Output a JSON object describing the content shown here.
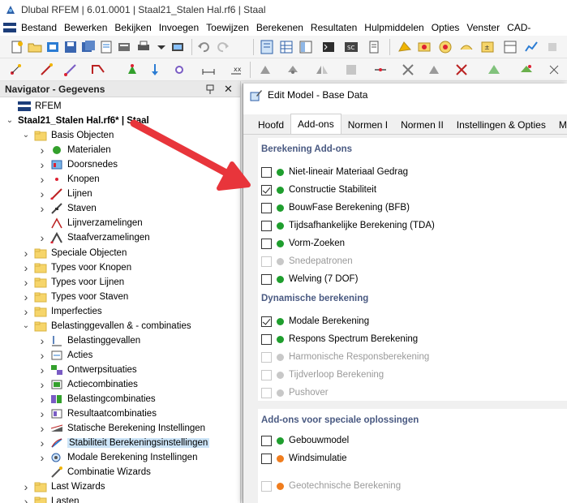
{
  "window": {
    "title": "Dlubal RFEM | 6.01.0001 | Staal21_Stalen Hal.rf6 | Staal"
  },
  "menu": [
    "Bestand",
    "Bewerken",
    "Bekijken",
    "Invoegen",
    "Toewijzen",
    "Berekenen",
    "Resultaten",
    "Hulpmiddelen",
    "Opties",
    "Venster",
    "CAD-"
  ],
  "navigator": {
    "title": "Navigator - Gegevens",
    "items": [
      {
        "label": "RFEM",
        "depth": 0,
        "chevron": "",
        "icon": "rfem-flag-icon"
      },
      {
        "label": "Staal21_Stalen Hal.rf6* | Staal",
        "depth": 0,
        "chevron": "open",
        "icon": "",
        "bold": true
      },
      {
        "label": "Basis Objecten",
        "depth": 1,
        "chevron": "open",
        "icon": "folder-icon"
      },
      {
        "label": "Materialen",
        "depth": 2,
        "chevron": "closed",
        "icon": "material-icon"
      },
      {
        "label": "Doorsnedes",
        "depth": 2,
        "chevron": "closed",
        "icon": "section-icon"
      },
      {
        "label": "Knopen",
        "depth": 2,
        "chevron": "closed",
        "icon": "node-icon"
      },
      {
        "label": "Lijnen",
        "depth": 2,
        "chevron": "closed",
        "icon": "line-icon"
      },
      {
        "label": "Staven",
        "depth": 2,
        "chevron": "closed",
        "icon": "member-icon"
      },
      {
        "label": "Lijnverzamelingen",
        "depth": 2,
        "chevron": "",
        "icon": "line-set-icon"
      },
      {
        "label": "Staafverzamelingen",
        "depth": 2,
        "chevron": "closed",
        "icon": "member-set-icon"
      },
      {
        "label": "Speciale Objecten",
        "depth": 1,
        "chevron": "closed",
        "icon": "folder-icon"
      },
      {
        "label": "Types voor Knopen",
        "depth": 1,
        "chevron": "closed",
        "icon": "folder-icon"
      },
      {
        "label": "Types voor Lijnen",
        "depth": 1,
        "chevron": "closed",
        "icon": "folder-icon"
      },
      {
        "label": "Types voor Staven",
        "depth": 1,
        "chevron": "closed",
        "icon": "folder-icon"
      },
      {
        "label": "Imperfecties",
        "depth": 1,
        "chevron": "closed",
        "icon": "folder-icon"
      },
      {
        "label": "Belastinggevallen & - combinaties",
        "depth": 1,
        "chevron": "open",
        "icon": "folder-icon"
      },
      {
        "label": "Belastinggevallen",
        "depth": 2,
        "chevron": "closed",
        "icon": "load-case-icon"
      },
      {
        "label": "Acties",
        "depth": 2,
        "chevron": "closed",
        "icon": "action-icon"
      },
      {
        "label": "Ontwerpsituaties",
        "depth": 2,
        "chevron": "closed",
        "icon": "design-situation-icon"
      },
      {
        "label": "Actiecombinaties",
        "depth": 2,
        "chevron": "closed",
        "icon": "action-combination-icon"
      },
      {
        "label": "Belastingcombinaties",
        "depth": 2,
        "chevron": "closed",
        "icon": "load-combination-icon"
      },
      {
        "label": "Resultaatcombinaties",
        "depth": 2,
        "chevron": "closed",
        "icon": "result-combination-icon"
      },
      {
        "label": "Statische Berekening Instellingen",
        "depth": 2,
        "chevron": "closed",
        "icon": "static-settings-icon"
      },
      {
        "label": "Stabiliteit Berekeningsinstellingen",
        "depth": 2,
        "chevron": "closed",
        "icon": "stability-settings-icon",
        "selected": true
      },
      {
        "label": "Modale Berekening Instellingen",
        "depth": 2,
        "chevron": "closed",
        "icon": "modal-settings-icon"
      },
      {
        "label": "Combinatie Wizards",
        "depth": 2,
        "chevron": "",
        "icon": "combination-wizard-icon"
      },
      {
        "label": "Last Wizards",
        "depth": 1,
        "chevron": "closed",
        "icon": "folder-icon"
      },
      {
        "label": "Lasten",
        "depth": 1,
        "chevron": "closed",
        "icon": "folder-icon"
      }
    ]
  },
  "dialog": {
    "title": "Edit Model - Base Data",
    "tabs": [
      "Hoofd",
      "Add-ons",
      "Normen I",
      "Normen II",
      "Instellingen & Opties",
      "M"
    ],
    "active_tab": 1,
    "groups": [
      {
        "title": "Berekening Add-ons",
        "options": [
          {
            "label": "Niet-lineair Materiaal Gedrag",
            "checked": false,
            "enabled": true,
            "dot": "#1f9e2e"
          },
          {
            "label": "Constructie Stabiliteit",
            "checked": true,
            "enabled": true,
            "dot": "#1f9e2e"
          },
          {
            "label": "BouwFase Berekening (BFB)",
            "checked": false,
            "enabled": true,
            "dot": "#1f9e2e"
          },
          {
            "label": "Tijdsafhankelijke Berekening (TDA)",
            "checked": false,
            "enabled": true,
            "dot": "#1f9e2e"
          },
          {
            "label": "Vorm-Zoeken",
            "checked": false,
            "enabled": true,
            "dot": "#1f9e2e"
          },
          {
            "label": "Snedepatronen",
            "checked": false,
            "enabled": false,
            "dot": "#c8c8c8"
          },
          {
            "label": "Welving (7 DOF)",
            "checked": false,
            "enabled": true,
            "dot": "#1f9e2e"
          }
        ]
      },
      {
        "title": "Dynamische berekening",
        "options": [
          {
            "label": "Modale Berekening",
            "checked": true,
            "enabled": true,
            "dot": "#1f9e2e"
          },
          {
            "label": "Respons Spectrum Berekening",
            "checked": false,
            "enabled": true,
            "dot": "#1f9e2e"
          },
          {
            "label": "Harmonische Responsberekening",
            "checked": false,
            "enabled": false,
            "dot": "#c8c8c8"
          },
          {
            "label": "Tijdverloop Berekening",
            "checked": false,
            "enabled": false,
            "dot": "#c8c8c8"
          },
          {
            "label": "Pushover",
            "checked": false,
            "enabled": false,
            "dot": "#c8c8c8"
          }
        ]
      },
      {
        "title": "Add-ons voor speciale oplossingen",
        "options": [
          {
            "label": "Gebouwmodel",
            "checked": false,
            "enabled": true,
            "dot": "#1f9e2e"
          },
          {
            "label": "Windsimulatie",
            "checked": false,
            "enabled": true,
            "dot": "#f07d1e"
          },
          {
            "label": "Geotechnische Berekening",
            "checked": false,
            "enabled": false,
            "dot": "#f07d1e"
          }
        ]
      }
    ]
  },
  "colors": {
    "accent": "#4a5a82",
    "arrow": "#e8353b",
    "selection": "#cce4f7",
    "enabled_dot": "#1f9e2e",
    "orange_dot": "#f07d1e"
  }
}
